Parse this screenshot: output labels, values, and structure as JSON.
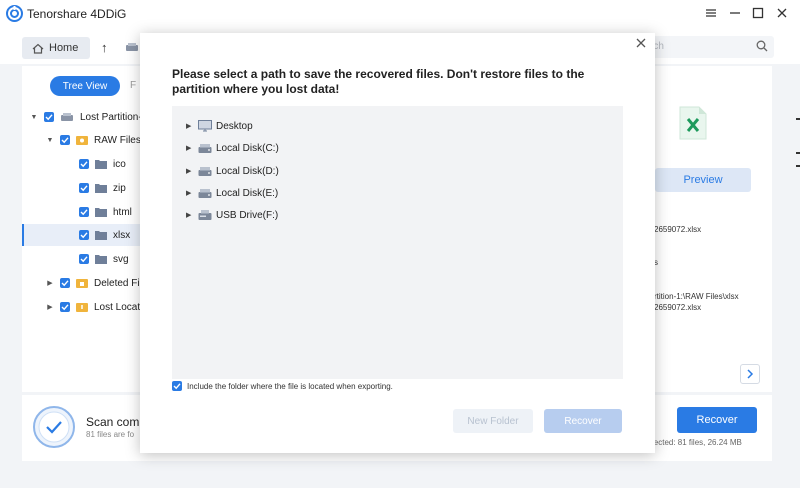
{
  "app": {
    "title": "Tenorshare 4DDiG"
  },
  "toolbar": {
    "home_label": "Home",
    "search_placeholder": "rch"
  },
  "left_panel": {
    "tabs": {
      "tree_view": "Tree View",
      "file_view_partial": "F"
    },
    "tree": [
      {
        "label": "Lost Partition-",
        "level": 0
      },
      {
        "label": "RAW Files",
        "level": 1
      },
      {
        "label": "ico",
        "level": 2
      },
      {
        "label": "zip",
        "level": 2
      },
      {
        "label": "html",
        "level": 2
      },
      {
        "label": "xlsx",
        "level": 2,
        "selected": true
      },
      {
        "label": "svg",
        "level": 2
      },
      {
        "label": "Deleted Fi",
        "level": 1
      },
      {
        "label": "Lost Locat",
        "level": 1
      }
    ]
  },
  "right_panel": {
    "preview_label": "Preview",
    "filename": "2659072.xlsx",
    "s_mark": "s",
    "path_line1": "rtition-1:\\RAW Files\\xlsx",
    "path_line2": "2659072.xlsx"
  },
  "status": {
    "scan_title": "Scan com",
    "scan_sub": "81 files are fo",
    "selected_info": "lected: 81 files, 26.24 MB",
    "recover_label": "Recover"
  },
  "modal": {
    "title": "Please select a path to save the recovered files. Don't restore files to the partition where you lost data!",
    "locations": [
      {
        "label": "Desktop",
        "icon": "desktop-icon"
      },
      {
        "label": "Local Disk(C:)",
        "icon": "disk-icon"
      },
      {
        "label": "Local Disk(D:)",
        "icon": "disk-icon"
      },
      {
        "label": "Local Disk(E:)",
        "icon": "disk-icon"
      },
      {
        "label": "USB Drive(F:)",
        "icon": "usb-icon"
      }
    ],
    "include_folder_label": "Include the folder where the file is located when exporting.",
    "include_folder_checked": true,
    "new_folder_label": "New Folder",
    "recover_label": "Recover"
  },
  "colors": {
    "accent": "#2a7be4",
    "recover_disabled": "#b7cdef",
    "excel_green": "#1d9a5c"
  }
}
